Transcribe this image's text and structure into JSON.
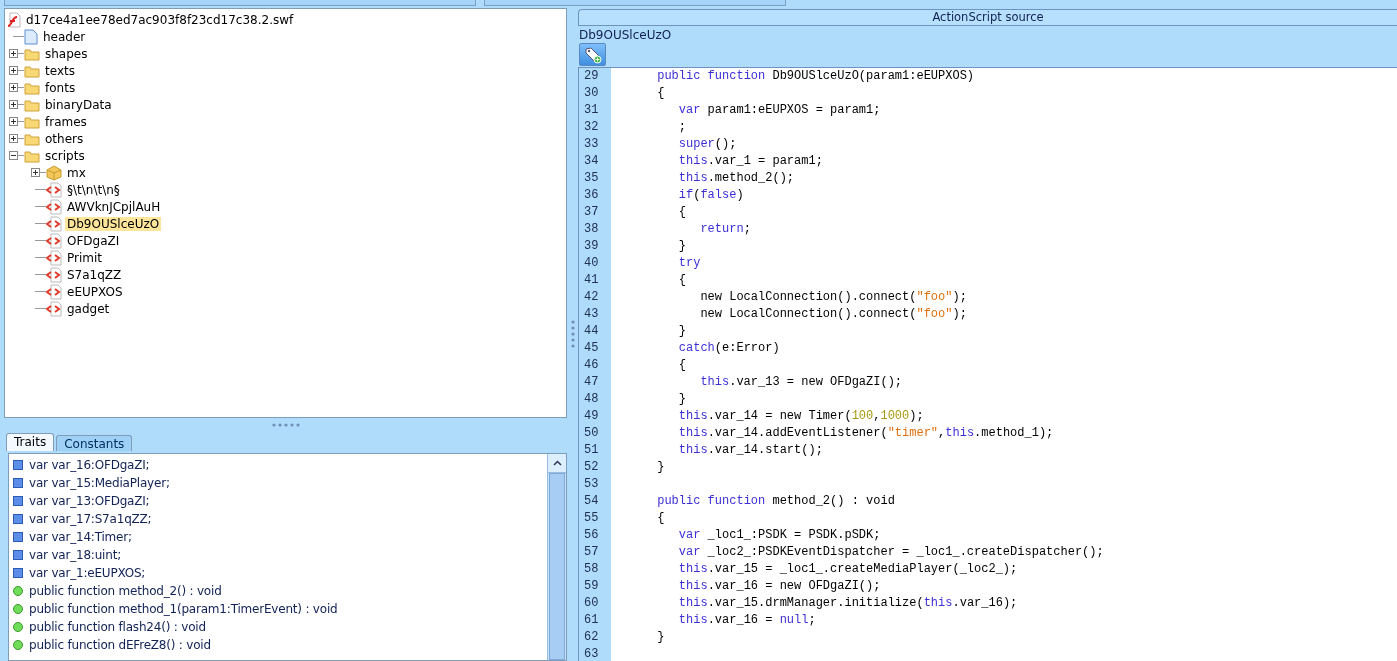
{
  "top_tabs": [
    {
      "selected": false
    },
    {
      "selected": false
    }
  ],
  "tree": {
    "label": "d17ce4a1ee78ed7ac903f8f23cd17c38.2.swf",
    "kind": "swf",
    "children": [
      {
        "label": "header",
        "kind": "document"
      },
      {
        "label": "shapes",
        "kind": "folder",
        "expanded": false
      },
      {
        "label": "texts",
        "kind": "folder",
        "expanded": false
      },
      {
        "label": "fonts",
        "kind": "folder",
        "expanded": false
      },
      {
        "label": "binaryData",
        "kind": "folder",
        "expanded": false
      },
      {
        "label": "frames",
        "kind": "folder",
        "expanded": false
      },
      {
        "label": "others",
        "kind": "folder",
        "expanded": false
      },
      {
        "label": "scripts",
        "kind": "folder",
        "expanded": true,
        "children": [
          {
            "label": "mx",
            "kind": "package",
            "expanded": false
          },
          {
            "label": "§\\t\\n\\t\\n§",
            "kind": "script",
            "selected": false
          },
          {
            "label": "AWVknJCpjlAuH",
            "kind": "script",
            "selected": false
          },
          {
            "label": "Db9OUSlceUzO",
            "kind": "script",
            "selected": true
          },
          {
            "label": "OFDgaZI",
            "kind": "script",
            "selected": false
          },
          {
            "label": "Primit",
            "kind": "script",
            "selected": false
          },
          {
            "label": "S7a1qZZ",
            "kind": "script",
            "selected": false
          },
          {
            "label": "eEUPXOS",
            "kind": "script",
            "selected": false
          },
          {
            "label": "gadget",
            "kind": "script",
            "selected": false
          }
        ]
      }
    ]
  },
  "bottom_tabs": [
    {
      "label": "Traits",
      "selected": true
    },
    {
      "label": "Constants",
      "selected": false
    }
  ],
  "traits": [
    {
      "kind": "var",
      "text": "var var_16:OFDgaZI;"
    },
    {
      "kind": "var",
      "text": "var var_15:MediaPlayer;"
    },
    {
      "kind": "var",
      "text": "var var_13:OFDgaZI;"
    },
    {
      "kind": "var",
      "text": "var var_17:S7a1qZZ;"
    },
    {
      "kind": "var",
      "text": "var var_14:Timer;"
    },
    {
      "kind": "var",
      "text": "var var_18:uint;"
    },
    {
      "kind": "var",
      "text": "var var_1:eEUPXOS;"
    },
    {
      "kind": "function",
      "text": "public function method_2() : void"
    },
    {
      "kind": "function",
      "text": "public function method_1(param1:TimerEvent) : void"
    },
    {
      "kind": "function",
      "text": "public function flash24() : void"
    },
    {
      "kind": "function",
      "text": "public function dEFreZ8() : void"
    }
  ],
  "source": {
    "header": "ActionScript source",
    "title": "Db9OUSlceUzO",
    "lines": [
      {
        "n": "29",
        "tokens": [
          {
            "kind": "keyword",
            "text": "      public"
          },
          {
            "kind": "keyword",
            "text": " function"
          },
          {
            "kind": "plain",
            "text": " Db9OUSlceUzO(param1:eEUPXOS)"
          }
        ]
      },
      {
        "n": "30",
        "tokens": [
          {
            "kind": "plain",
            "text": "      {"
          }
        ]
      },
      {
        "n": "31",
        "tokens": [
          {
            "kind": "keyword",
            "text": "         var"
          },
          {
            "kind": "plain",
            "text": " param1:eEUPXOS = param1;"
          }
        ]
      },
      {
        "n": "32",
        "tokens": [
          {
            "kind": "plain",
            "text": "         ;"
          }
        ]
      },
      {
        "n": "33",
        "tokens": [
          {
            "kind": "keyword",
            "text": "         super"
          },
          {
            "kind": "plain",
            "text": "();"
          }
        ]
      },
      {
        "n": "34",
        "tokens": [
          {
            "kind": "keyword",
            "text": "         this"
          },
          {
            "kind": "plain",
            "text": ".var_1 = param1;"
          }
        ]
      },
      {
        "n": "35",
        "tokens": [
          {
            "kind": "keyword",
            "text": "         this"
          },
          {
            "kind": "plain",
            "text": ".method_2();"
          }
        ]
      },
      {
        "n": "36",
        "tokens": [
          {
            "kind": "keyword",
            "text": "         if"
          },
          {
            "kind": "plain",
            "text": "("
          },
          {
            "kind": "keyword",
            "text": "false"
          },
          {
            "kind": "plain",
            "text": ")"
          }
        ]
      },
      {
        "n": "37",
        "tokens": [
          {
            "kind": "plain",
            "text": "         {"
          }
        ]
      },
      {
        "n": "38",
        "tokens": [
          {
            "kind": "keyword",
            "text": "            return"
          },
          {
            "kind": "plain",
            "text": ";"
          }
        ]
      },
      {
        "n": "39",
        "tokens": [
          {
            "kind": "plain",
            "text": "         }"
          }
        ]
      },
      {
        "n": "40",
        "tokens": [
          {
            "kind": "keyword",
            "text": "         try"
          }
        ]
      },
      {
        "n": "41",
        "tokens": [
          {
            "kind": "plain",
            "text": "         {"
          }
        ]
      },
      {
        "n": "42",
        "tokens": [
          {
            "kind": "plain",
            "text": "            new LocalConnection().connect("
          },
          {
            "kind": "string",
            "text": "\"foo\""
          },
          {
            "kind": "plain",
            "text": ");"
          }
        ]
      },
      {
        "n": "43",
        "tokens": [
          {
            "kind": "plain",
            "text": "            new LocalConnection().connect("
          },
          {
            "kind": "string",
            "text": "\"foo\""
          },
          {
            "kind": "plain",
            "text": ");"
          }
        ]
      },
      {
        "n": "44",
        "tokens": [
          {
            "kind": "plain",
            "text": "         }"
          }
        ]
      },
      {
        "n": "45",
        "tokens": [
          {
            "kind": "keyword",
            "text": "         catch"
          },
          {
            "kind": "plain",
            "text": "(e:Error)"
          }
        ]
      },
      {
        "n": "46",
        "tokens": [
          {
            "kind": "plain",
            "text": "         {"
          }
        ]
      },
      {
        "n": "47",
        "tokens": [
          {
            "kind": "keyword",
            "text": "            this"
          },
          {
            "kind": "plain",
            "text": ".var_13 = new OFDgaZI();"
          }
        ]
      },
      {
        "n": "48",
        "tokens": [
          {
            "kind": "plain",
            "text": "         }"
          }
        ]
      },
      {
        "n": "49",
        "tokens": [
          {
            "kind": "keyword",
            "text": "         this"
          },
          {
            "kind": "plain",
            "text": ".var_14 = new Timer("
          },
          {
            "kind": "number",
            "text": "100"
          },
          {
            "kind": "plain",
            "text": ","
          },
          {
            "kind": "number",
            "text": "1000"
          },
          {
            "kind": "plain",
            "text": ");"
          }
        ]
      },
      {
        "n": "50",
        "tokens": [
          {
            "kind": "keyword",
            "text": "         this"
          },
          {
            "kind": "plain",
            "text": ".var_14.addEventListener("
          },
          {
            "kind": "string",
            "text": "\"timer\""
          },
          {
            "kind": "plain",
            "text": ","
          },
          {
            "kind": "keyword",
            "text": "this"
          },
          {
            "kind": "plain",
            "text": ".method_1);"
          }
        ]
      },
      {
        "n": "51",
        "tokens": [
          {
            "kind": "keyword",
            "text": "         this"
          },
          {
            "kind": "plain",
            "text": ".var_14.start();"
          }
        ]
      },
      {
        "n": "52",
        "tokens": [
          {
            "kind": "plain",
            "text": "      }"
          }
        ]
      },
      {
        "n": "53"
      },
      {
        "n": "54",
        "tokens": [
          {
            "kind": "keyword",
            "text": "      public"
          },
          {
            "kind": "keyword",
            "text": " function"
          },
          {
            "kind": "plain",
            "text": " method_2() : void"
          }
        ]
      },
      {
        "n": "55",
        "tokens": [
          {
            "kind": "plain",
            "text": "      {"
          }
        ]
      },
      {
        "n": "56",
        "tokens": [
          {
            "kind": "keyword",
            "text": "         var"
          },
          {
            "kind": "plain",
            "text": " _loc1_:PSDK = PSDK.pSDK;"
          }
        ]
      },
      {
        "n": "57",
        "tokens": [
          {
            "kind": "keyword",
            "text": "         var"
          },
          {
            "kind": "plain",
            "text": " _loc2_:PSDKEventDispatcher = _loc1_.createDispatcher();"
          }
        ]
      },
      {
        "n": "58",
        "tokens": [
          {
            "kind": "keyword",
            "text": "         this"
          },
          {
            "kind": "plain",
            "text": ".var_15 = _loc1_.createMediaPlayer(_loc2_);"
          }
        ]
      },
      {
        "n": "59",
        "tokens": [
          {
            "kind": "keyword",
            "text": "         this"
          },
          {
            "kind": "plain",
            "text": ".var_16 = new OFDgaZI();"
          }
        ]
      },
      {
        "n": "60",
        "tokens": [
          {
            "kind": "keyword",
            "text": "         this"
          },
          {
            "kind": "plain",
            "text": ".var_15.drmManager.initialize("
          },
          {
            "kind": "keyword",
            "text": "this"
          },
          {
            "kind": "plain",
            "text": ".var_16);"
          }
        ]
      },
      {
        "n": "61",
        "tokens": [
          {
            "kind": "keyword",
            "text": "         this"
          },
          {
            "kind": "plain",
            "text": ".var_16 = "
          },
          {
            "kind": "keyword",
            "text": "null"
          },
          {
            "kind": "plain",
            "text": ";"
          }
        ]
      },
      {
        "n": "62",
        "tokens": [
          {
            "kind": "plain",
            "text": "      }"
          }
        ]
      },
      {
        "n": "63"
      }
    ]
  }
}
